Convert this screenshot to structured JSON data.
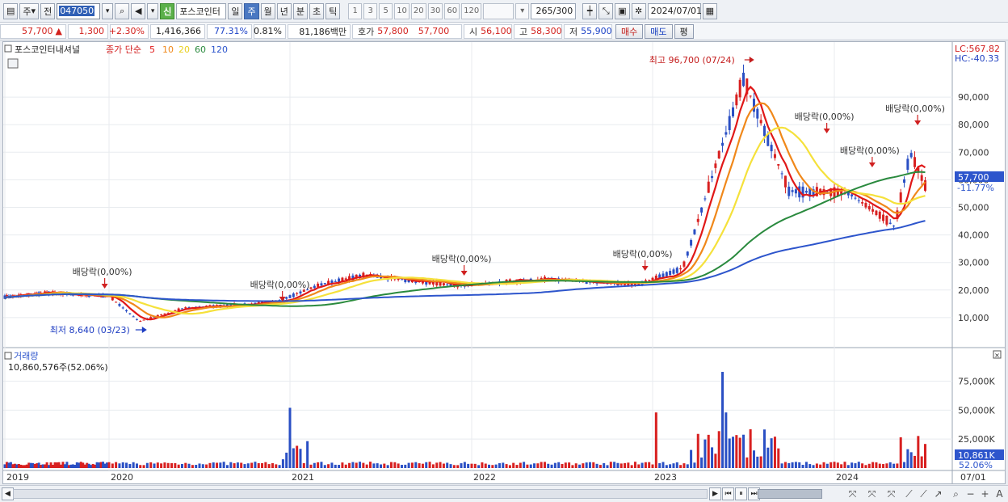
{
  "toolbar": {
    "market": "주",
    "period_label": "전",
    "code": "047050",
    "new_badge": "신",
    "stock_name": "포스코인터",
    "tabs": [
      "일",
      "주",
      "월",
      "년",
      "분",
      "초",
      "틱"
    ],
    "active_tab": "주",
    "intervals": [
      "1",
      "3",
      "5",
      "10",
      "20",
      "30",
      "60",
      "120"
    ],
    "count": "265",
    "count_total": "/300",
    "date": "2024/07/01"
  },
  "info": {
    "price": "57,700",
    "change": "1,300",
    "change_pct": "+2.30%",
    "volume": "1,416,366",
    "vol_ratio": "77.31%",
    "turnover": "0.81%",
    "amount": "81,186백만",
    "ask_label": "호가",
    "ask1": "57,800",
    "ask2": "57,700",
    "open_label": "시",
    "open": "56,100",
    "high_label": "고",
    "high": "58,300",
    "low_label": "저",
    "low": "55,900",
    "buy": "매수",
    "sell": "매도",
    "avg": "평"
  },
  "chart": {
    "legend_name": "포스코인터내셔널",
    "legend_ma_label": "종가 단순",
    "legend_ma_values": [
      "5",
      "10",
      "20",
      "60",
      "120"
    ],
    "colors": {
      "ma5": "#e01818",
      "ma10": "#f0881a",
      "ma20": "#f5e13b",
      "ma60": "#2a8a3e",
      "ma120": "#2d55cc",
      "up": "#d82020",
      "down": "#2a4fc4"
    },
    "lc": "LC:567.82",
    "hc": "HC:-40.33",
    "current_price": "57,700",
    "current_pct": "-11.77%",
    "price_ticks": [
      "90,000",
      "80,000",
      "70,000",
      "60,000",
      "50,000",
      "40,000",
      "30,000",
      "20,000",
      "10,000"
    ],
    "high_marker": "최고 96,700 (07/24)",
    "low_marker": "최저 8,640 (03/23)",
    "dividend_label": "배당락(0,00%)",
    "volume_title": "거래량",
    "volume_info": "10,860,576주(52.06%)",
    "volume_ticks": [
      "75,000K",
      "50,000K",
      "25,000K"
    ],
    "volume_current": "10,861K",
    "volume_current_pct": "52.06%",
    "x_labels": [
      "2019",
      "2020",
      "2021",
      "2022",
      "2023",
      "2024",
      "07/01"
    ]
  },
  "chart_data": {
    "type": "candlestick",
    "title": "포스코인터내셔널",
    "x_range": [
      "2019",
      "2024/07/01"
    ],
    "ylim": [
      0,
      100000
    ],
    "price_points": [
      {
        "date": "2019-01",
        "close": 17500
      },
      {
        "date": "2019-06",
        "close": 19000
      },
      {
        "date": "2020-01",
        "close": 17800
      },
      {
        "date": "2020-03",
        "close": 8640
      },
      {
        "date": "2020-06",
        "close": 13500
      },
      {
        "date": "2020-12",
        "close": 15500
      },
      {
        "date": "2021-03",
        "close": 22000
      },
      {
        "date": "2021-06",
        "close": 25500
      },
      {
        "date": "2021-12",
        "close": 21500
      },
      {
        "date": "2022-06",
        "close": 24000
      },
      {
        "date": "2022-12",
        "close": 22000
      },
      {
        "date": "2023-03",
        "close": 28000
      },
      {
        "date": "2023-07",
        "close": 96700
      },
      {
        "date": "2023-10",
        "close": 56000
      },
      {
        "date": "2024-02",
        "close": 55000
      },
      {
        "date": "2024-05",
        "close": 43000
      },
      {
        "date": "2024-06",
        "close": 70000
      },
      {
        "date": "2024-07",
        "close": 57700
      }
    ],
    "volume_ylim": [
      0,
      90000
    ],
    "volume_unit": "K",
    "dividend_events": [
      "2019-12",
      "2020-12",
      "2021-12",
      "2022-12",
      "2023-12",
      "2024-03",
      "2024-06"
    ]
  }
}
